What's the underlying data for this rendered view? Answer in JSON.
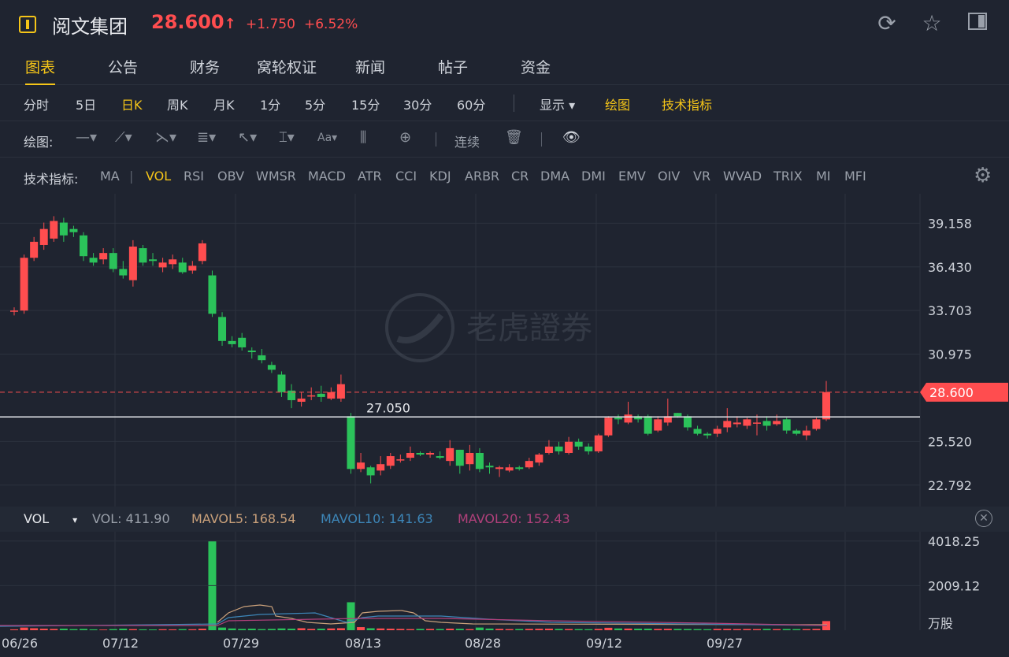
{
  "header": {
    "name": "阅文集团",
    "price": "28.600",
    "arrow": "↑",
    "change": "+1.750",
    "change_pct": "+6.52%"
  },
  "tabs": [
    "图表",
    "公告",
    "财务",
    "窝轮权证",
    "新闻",
    "帖子",
    "资金"
  ],
  "periods": [
    "分时",
    "5日",
    "日K",
    "周K",
    "月K",
    "1分",
    "5分",
    "15分",
    "30分",
    "60分"
  ],
  "period_extra": {
    "display": "显示",
    "draw": "绘图",
    "indicators": "技术指标"
  },
  "drawbar": {
    "label": "绘图:",
    "continuous": "连续"
  },
  "indicators": {
    "label": "技术指标:",
    "items": [
      "MA",
      "VOL",
      "RSI",
      "OBV",
      "WMSR",
      "MACD",
      "ATR",
      "CCI",
      "KDJ",
      "ARBR",
      "CR",
      "DMA",
      "DMI",
      "EMV",
      "OIV",
      "VR",
      "WVAD",
      "TRIX",
      "MI",
      "MFI"
    ]
  },
  "vol_legend": {
    "name": "VOL",
    "vol": "VOL: 411.90",
    "mavol5": "MAVOL5: 168.54",
    "mavol10": "MAVOL10: 141.63",
    "mavol20": "MAVOL20: 152.43"
  },
  "watermark": "老虎證券",
  "colors": {
    "up": "#ff4d4f",
    "down": "#2bc25a",
    "accent": "#f5c518",
    "mavol5": "#c9a07a",
    "mavol10": "#3d86b8",
    "mavol20": "#b0407a"
  },
  "chart_data": {
    "type": "candlestick",
    "price_ticks": [
      "39.158",
      "36.430",
      "33.703",
      "30.975",
      "25.520",
      "22.792"
    ],
    "current_price": "28.600",
    "line_marker": "27.050",
    "ylim": [
      21.5,
      41.0
    ],
    "date_labels": [
      "06/26",
      "07/12",
      "07/29",
      "08/13",
      "08/28",
      "09/12",
      "09/27"
    ],
    "vol_ticks": [
      "4018.25",
      "2009.12",
      "万股"
    ],
    "candles": [
      [
        33.7,
        33.7,
        33.4,
        33.9
      ],
      [
        33.7,
        37.0,
        33.5,
        37.2
      ],
      [
        37.0,
        38.0,
        36.8,
        38.3
      ],
      [
        37.8,
        38.8,
        37.5,
        39.2
      ],
      [
        38.2,
        39.3,
        38.0,
        39.6
      ],
      [
        39.2,
        38.4,
        38.0,
        39.5
      ],
      [
        38.8,
        38.6,
        38.3,
        39.0
      ],
      [
        38.4,
        37.1,
        36.8,
        38.6
      ],
      [
        37.0,
        36.7,
        36.5,
        37.3
      ],
      [
        36.9,
        37.3,
        36.6,
        37.6
      ],
      [
        37.3,
        36.3,
        36.1,
        37.6
      ],
      [
        36.3,
        35.9,
        35.7,
        36.8
      ],
      [
        35.6,
        37.7,
        35.2,
        38.1
      ],
      [
        37.6,
        36.7,
        36.5,
        37.8
      ],
      [
        36.9,
        36.8,
        36.5,
        37.3
      ],
      [
        36.4,
        36.7,
        36.1,
        37.0
      ],
      [
        36.6,
        36.9,
        36.3,
        37.2
      ],
      [
        36.7,
        36.1,
        36.0,
        37.0
      ],
      [
        36.2,
        36.5,
        36.0,
        36.8
      ],
      [
        36.8,
        37.9,
        36.6,
        38.1
      ],
      [
        35.9,
        33.5,
        33.3,
        36.2
      ],
      [
        33.3,
        31.8,
        31.5,
        33.6
      ],
      [
        31.8,
        31.6,
        31.4,
        32.1
      ],
      [
        32.0,
        31.4,
        31.2,
        32.3
      ],
      [
        31.2,
        31.1,
        30.7,
        31.4
      ],
      [
        30.9,
        30.6,
        30.4,
        31.3
      ],
      [
        30.3,
        30.0,
        29.8,
        30.5
      ],
      [
        29.7,
        28.6,
        28.3,
        29.9
      ],
      [
        28.7,
        28.1,
        27.6,
        29.1
      ],
      [
        28.0,
        28.2,
        27.7,
        28.6
      ],
      [
        28.4,
        28.4,
        28.1,
        28.9
      ],
      [
        28.5,
        28.3,
        28.0,
        29.0
      ],
      [
        28.2,
        28.6,
        28.1,
        28.9
      ],
      [
        28.2,
        29.1,
        28.0,
        29.7
      ],
      [
        27.1,
        23.8,
        23.5,
        27.3
      ],
      [
        23.8,
        24.2,
        23.6,
        24.8
      ],
      [
        23.9,
        23.4,
        22.9,
        24.0
      ],
      [
        23.7,
        24.1,
        23.4,
        24.6
      ],
      [
        24.0,
        24.6,
        23.8,
        24.8
      ],
      [
        24.4,
        24.4,
        24.2,
        24.7
      ],
      [
        24.5,
        24.8,
        24.3,
        25.2
      ],
      [
        24.8,
        24.7,
        24.6,
        24.9
      ],
      [
        24.7,
        24.8,
        24.5,
        24.9
      ],
      [
        24.6,
        24.5,
        24.4,
        24.9
      ],
      [
        24.3,
        25.1,
        24.0,
        25.6
      ],
      [
        25.0,
        24.0,
        23.5,
        25.0
      ],
      [
        24.1,
        24.8,
        23.7,
        25.3
      ],
      [
        24.8,
        23.8,
        23.6,
        25.1
      ],
      [
        24.0,
        23.9,
        23.5,
        24.2
      ],
      [
        23.8,
        23.9,
        23.3,
        24.0
      ],
      [
        23.7,
        23.9,
        23.6,
        24.1
      ],
      [
        23.9,
        23.8,
        23.7,
        24.0
      ],
      [
        23.9,
        24.3,
        23.8,
        24.5
      ],
      [
        24.2,
        24.7,
        24.0,
        24.8
      ],
      [
        24.8,
        25.2,
        24.7,
        25.6
      ],
      [
        25.2,
        24.9,
        24.7,
        25.5
      ],
      [
        24.8,
        25.5,
        24.7,
        25.8
      ],
      [
        25.5,
        25.2,
        25.0,
        25.7
      ],
      [
        25.2,
        24.9,
        24.7,
        25.4
      ],
      [
        24.9,
        25.9,
        24.8,
        26.0
      ],
      [
        25.9,
        27.0,
        25.8,
        27.1
      ],
      [
        27.0,
        26.9,
        26.6,
        27.2
      ],
      [
        26.7,
        27.2,
        26.6,
        28.0
      ],
      [
        27.1,
        26.9,
        26.7,
        27.2
      ],
      [
        27.1,
        26.0,
        25.9,
        27.2
      ],
      [
        26.2,
        26.9,
        26.1,
        27.1
      ],
      [
        26.7,
        27.1,
        26.5,
        28.2
      ],
      [
        27.3,
        27.1,
        27.0,
        27.3
      ],
      [
        27.1,
        26.4,
        26.2,
        27.2
      ],
      [
        26.3,
        26.0,
        25.9,
        26.5
      ],
      [
        26.0,
        25.9,
        25.7,
        26.1
      ],
      [
        26.0,
        26.3,
        25.8,
        26.5
      ],
      [
        26.4,
        26.8,
        26.1,
        27.6
      ],
      [
        26.6,
        26.7,
        26.4,
        27.1
      ],
      [
        26.5,
        26.9,
        26.3,
        27.0
      ],
      [
        26.7,
        26.7,
        25.9,
        27.2
      ],
      [
        26.8,
        26.5,
        26.2,
        27.1
      ],
      [
        26.6,
        26.8,
        26.5,
        27.2
      ],
      [
        26.9,
        26.2,
        26.0,
        27.0
      ],
      [
        26.2,
        26.0,
        25.9,
        26.3
      ],
      [
        25.9,
        26.2,
        25.6,
        26.5
      ],
      [
        26.3,
        26.9,
        26.2,
        27.0
      ],
      [
        26.9,
        28.6,
        26.8,
        29.3
      ]
    ],
    "volumes": [
      40,
      120,
      90,
      70,
      60,
      70,
      50,
      60,
      40,
      30,
      50,
      70,
      50,
      40,
      35,
      45,
      40,
      50,
      45,
      70,
      4018,
      120,
      80,
      60,
      70,
      50,
      60,
      80,
      70,
      90,
      60,
      70,
      80,
      90,
      1260,
      140,
      90,
      80,
      70,
      60,
      50,
      60,
      60,
      55,
      70,
      65,
      50,
      120,
      75,
      60,
      50,
      55,
      60,
      65,
      70,
      60,
      55,
      50,
      45,
      60,
      110,
      80,
      75,
      70,
      70,
      60,
      65,
      60,
      55,
      50,
      45,
      60,
      60,
      50,
      55,
      50,
      60,
      50,
      55,
      50,
      50,
      60,
      412
    ],
    "mavol5_points": [
      [
        276,
        790
      ],
      [
        290,
        778
      ],
      [
        310,
        770
      ],
      [
        330,
        768
      ],
      [
        345,
        770
      ],
      [
        350,
        782
      ],
      [
        370,
        785
      ],
      [
        390,
        790
      ],
      [
        420,
        792
      ],
      [
        450,
        790
      ],
      [
        460,
        778
      ],
      [
        480,
        776
      ],
      [
        510,
        775
      ],
      [
        525,
        778
      ],
      [
        540,
        788
      ],
      [
        560,
        790
      ],
      [
        600,
        792
      ],
      [
        1050,
        793
      ]
    ],
    "mavol10_points": [
      [
        0,
        795
      ],
      [
        200,
        793
      ],
      [
        276,
        792
      ],
      [
        290,
        784
      ],
      [
        330,
        780
      ],
      [
        400,
        778
      ],
      [
        420,
        784
      ],
      [
        440,
        790
      ],
      [
        460,
        784
      ],
      [
        480,
        782
      ],
      [
        560,
        782
      ],
      [
        620,
        786
      ],
      [
        700,
        790
      ],
      [
        1050,
        794
      ]
    ],
    "mavol20_points": [
      [
        0,
        794
      ],
      [
        276,
        794
      ],
      [
        290,
        788
      ],
      [
        400,
        786
      ],
      [
        460,
        785
      ],
      [
        560,
        785
      ],
      [
        700,
        788
      ],
      [
        900,
        791
      ],
      [
        1050,
        794
      ]
    ]
  }
}
